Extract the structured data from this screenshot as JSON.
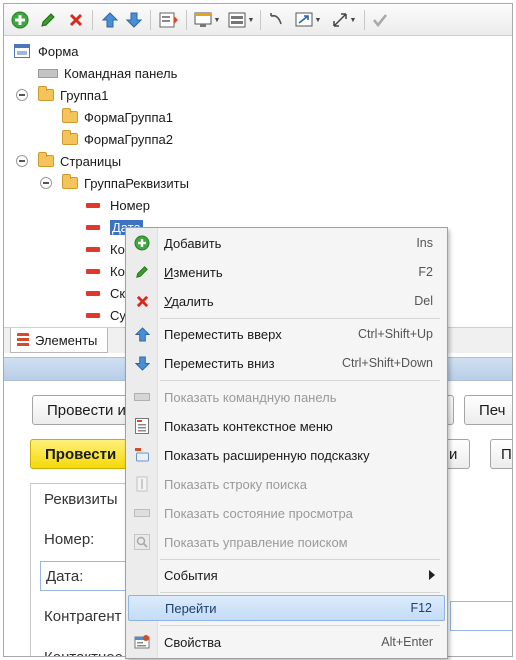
{
  "tree": {
    "root": "Форма",
    "command_panel": "Командная панель",
    "group1": "Группа1",
    "form_group1": "ФормаГруппа1",
    "form_group2": "ФормаГруппа2",
    "pages": "Страницы",
    "req_group": "ГруппаРеквизиты",
    "number": "Номер",
    "date": "Дата",
    "f3": "Ко",
    "f4": "Ко",
    "f5": "Ск",
    "f6": "Су"
  },
  "tabs": {
    "elements": "Элементы"
  },
  "preview": {
    "btn_post_close": "Провести и",
    "btn_print": "Печ",
    "btn_post": "Провести",
    "btn_right_mid": "и",
    "btn_right_small": "П",
    "tab_requisites": "Реквизиты",
    "label_number": "Номер:",
    "label_date": "Дата:",
    "label_counterparty": "Контрагент",
    "label_contact": "Контактное"
  },
  "menu": {
    "add": {
      "prefix": "",
      "accel": "Д",
      "rest": "обавить",
      "shortcut": "Ins"
    },
    "edit": {
      "prefix": "",
      "accel": "И",
      "rest": "зменить",
      "shortcut": "F2"
    },
    "delete": {
      "prefix": "",
      "accel": "У",
      "rest": "далить",
      "shortcut": "Del"
    },
    "move_up": {
      "label": "Переместить вверх",
      "shortcut": "Ctrl+Shift+Up"
    },
    "move_down": {
      "label": "Переместить вниз",
      "shortcut": "Ctrl+Shift+Down"
    },
    "show_cmd_panel": {
      "label": "Показать командную панель"
    },
    "show_ctx_menu": {
      "label": "Показать контекстное меню"
    },
    "show_ext_tooltip": {
      "label": "Показать расширенную подсказку"
    },
    "show_search_bar": {
      "label": "Показать строку поиска"
    },
    "show_view_state": {
      "label": "Показать состояние просмотра"
    },
    "show_search_ctrl": {
      "label": "Показать управление поиском"
    },
    "events": {
      "label": "События"
    },
    "goto": {
      "label": "Перейти",
      "shortcut": "F12"
    },
    "properties": {
      "label": "Свойства",
      "shortcut": "Alt+Enter"
    }
  },
  "colors": {
    "accent": "#3b73c2",
    "post_button": "#f5d90a",
    "field_icon": "#e0382b",
    "folder": "#f3c45c"
  }
}
